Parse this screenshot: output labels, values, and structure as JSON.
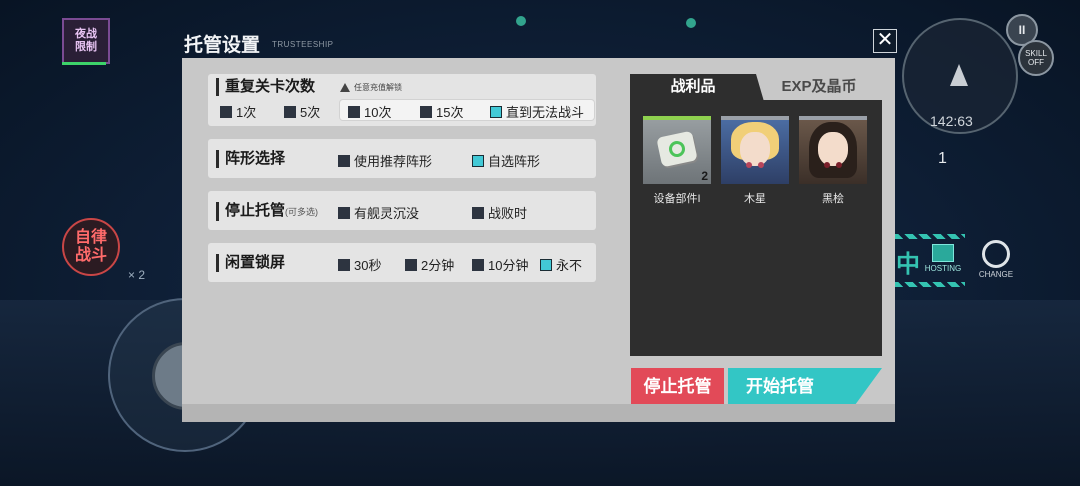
{
  "hud": {
    "night_badge": "夜战\n限制",
    "auto_battle": "自律\n战斗",
    "x_mark": "× 2",
    "radar_time": "142:63",
    "pause_icon": "II",
    "skill_label": "SKILL\nOFF",
    "count_value": "1",
    "hosting_label": "HOSTING",
    "hosting_char": "中",
    "change_label": "CHANGE"
  },
  "modal": {
    "title": "托管设置",
    "title_sub": "TRUSTEESHIP",
    "close_icon": "✕"
  },
  "repeat": {
    "title": "重复关卡次数",
    "warning": "任意充值解锁",
    "options": [
      {
        "label": "1次",
        "checked": false
      },
      {
        "label": "5次",
        "checked": false
      },
      {
        "label": "10次",
        "checked": false
      },
      {
        "label": "15次",
        "checked": false
      },
      {
        "label": "直到无法战斗",
        "checked": true
      }
    ]
  },
  "formation": {
    "title": "阵形选择",
    "options": [
      {
        "label": "使用推荐阵形",
        "checked": false
      },
      {
        "label": "自选阵形",
        "checked": true
      }
    ]
  },
  "stop": {
    "title": "停止托管",
    "title_note": "(可多选)",
    "options": [
      {
        "label": "有舰灵沉没",
        "checked": false
      },
      {
        "label": "战败时",
        "checked": false
      }
    ]
  },
  "idle": {
    "title": "闲置锁屏",
    "options": [
      {
        "label": "30秒",
        "checked": false
      },
      {
        "label": "2分钟",
        "checked": false
      },
      {
        "label": "10分钟",
        "checked": false
      },
      {
        "label": "永不",
        "checked": true
      }
    ]
  },
  "loot": {
    "tab_active": "战利品",
    "tab_inactive": "EXP及晶币",
    "items": [
      {
        "label": "设备部件I",
        "count": "2",
        "bar_color": "#8fd14f"
      },
      {
        "label": "木星",
        "count": "",
        "bar_color": "#9aa0a8"
      },
      {
        "label": "黑桧",
        "count": "",
        "bar_color": "#9aa0a8"
      }
    ]
  },
  "buttons": {
    "stop": "停止托管",
    "start": "开始托管"
  },
  "colors": {
    "checkbox_on": "#42c9d6",
    "checkbox_off": "#2d3440",
    "stop_button": "#e24a58",
    "start_button": "#33c6c5",
    "part_bar": "#8fd14f"
  }
}
